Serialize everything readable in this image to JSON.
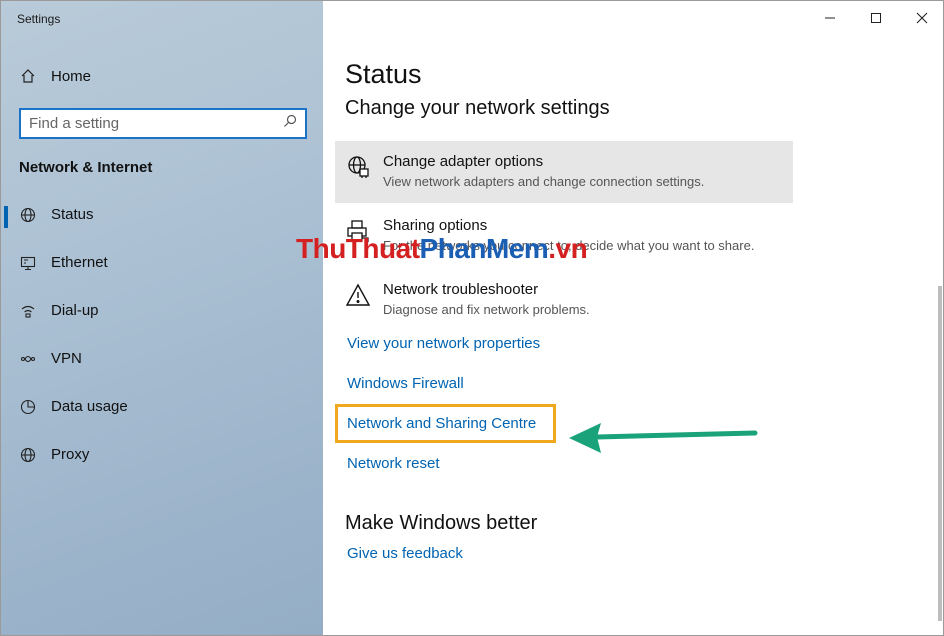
{
  "app": {
    "title": "Settings"
  },
  "sidebar": {
    "home_label": "Home",
    "search_placeholder": "Find a setting",
    "section_title": "Network & Internet",
    "items": [
      {
        "label": "Status",
        "icon": "globe-icon",
        "active": true
      },
      {
        "label": "Ethernet",
        "icon": "ethernet-icon",
        "active": false
      },
      {
        "label": "Dial-up",
        "icon": "dialup-icon",
        "active": false
      },
      {
        "label": "VPN",
        "icon": "vpn-icon",
        "active": false
      },
      {
        "label": "Data usage",
        "icon": "data-usage-icon",
        "active": false
      },
      {
        "label": "Proxy",
        "icon": "globe-icon",
        "active": false
      }
    ]
  },
  "main": {
    "title": "Status",
    "subtitle": "Change your network settings",
    "options": [
      {
        "title": "Change adapter options",
        "desc": "View network adapters and change connection settings.",
        "icon": "adapter-icon"
      },
      {
        "title": "Sharing options",
        "desc": "For the networks you connect to, decide what you want to share.",
        "icon": "printer-icon"
      },
      {
        "title": "Network troubleshooter",
        "desc": "Diagnose and fix network problems.",
        "icon": "warning-icon"
      }
    ],
    "links": [
      "View your network properties",
      "Windows Firewall",
      "Network and Sharing Centre",
      "Network reset"
    ],
    "better_heading": "Make Windows better",
    "feedback_link": "Give us feedback"
  },
  "watermark": {
    "part1": "ThuThuat",
    "part2": "PhanMem",
    "part3": ".vn"
  },
  "colors": {
    "accent": "#0063b1",
    "highlight": "#f0a81e",
    "arrow": "#1aa37a"
  }
}
